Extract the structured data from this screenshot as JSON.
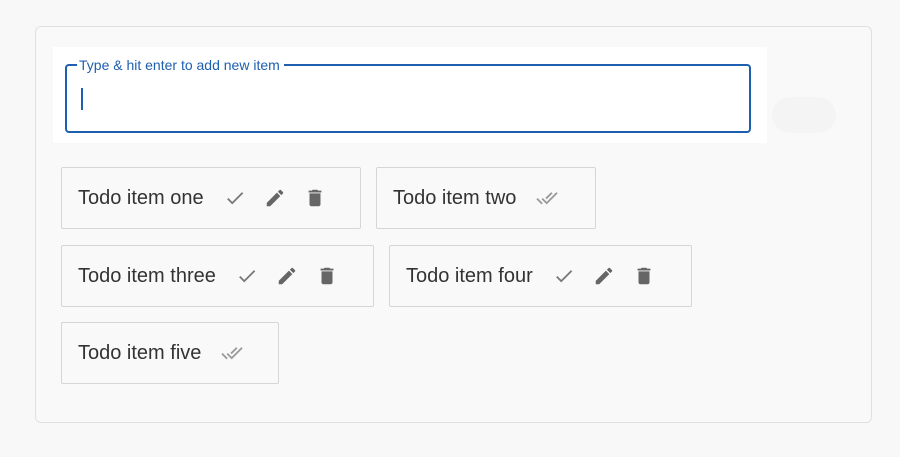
{
  "input": {
    "label": "Type & hit enter to add new item",
    "value": ""
  },
  "todos": [
    {
      "label": "Todo item one",
      "completed": false
    },
    {
      "label": "Todo item two",
      "completed": true
    },
    {
      "label": "Todo item three",
      "completed": false
    },
    {
      "label": "Todo item four",
      "completed": false
    },
    {
      "label": "Todo item five",
      "completed": true
    }
  ],
  "icons": {
    "complete": "check-icon",
    "edit": "pencil-icon",
    "delete": "trash-icon",
    "completed": "double-check-icon"
  },
  "colors": {
    "accent": "#1e5faf",
    "icon": "#777777",
    "icon_done": "#999999",
    "text": "#333333"
  }
}
